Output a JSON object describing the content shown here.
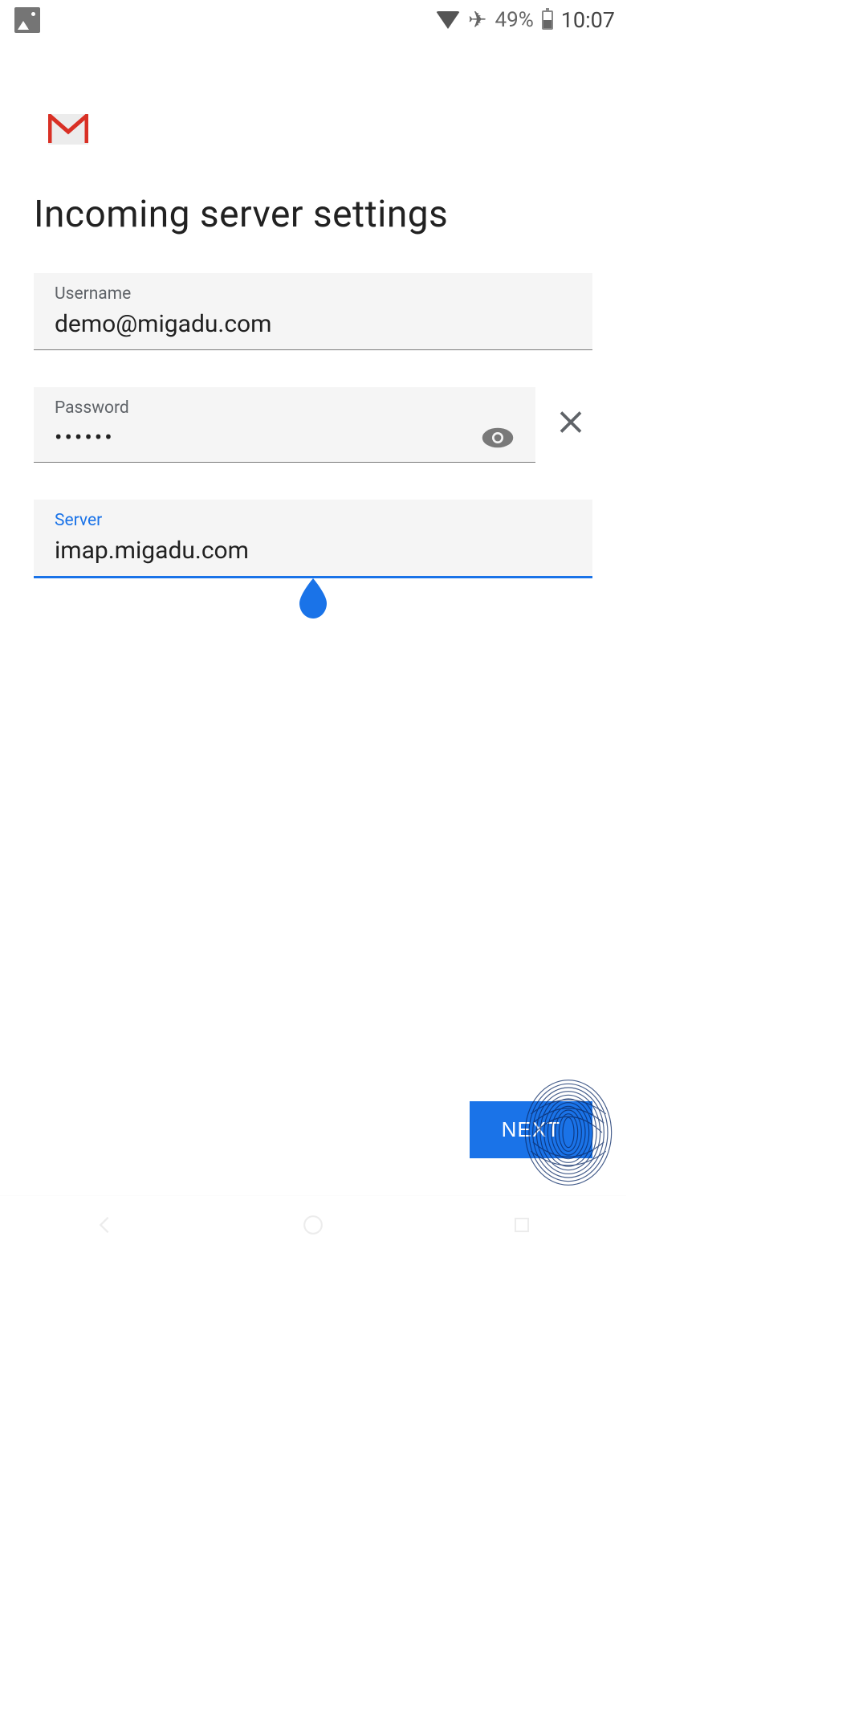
{
  "statusbar": {
    "battery_pct": "49%",
    "time": "10:07"
  },
  "header": {
    "title": "Incoming server settings"
  },
  "form": {
    "username": {
      "label": "Username",
      "value": "demo@migadu.com"
    },
    "password": {
      "label": "Password",
      "value": "••••••"
    },
    "server": {
      "label": "Server",
      "value": "imap.migadu.com"
    }
  },
  "buttons": {
    "next": "NEXT"
  }
}
